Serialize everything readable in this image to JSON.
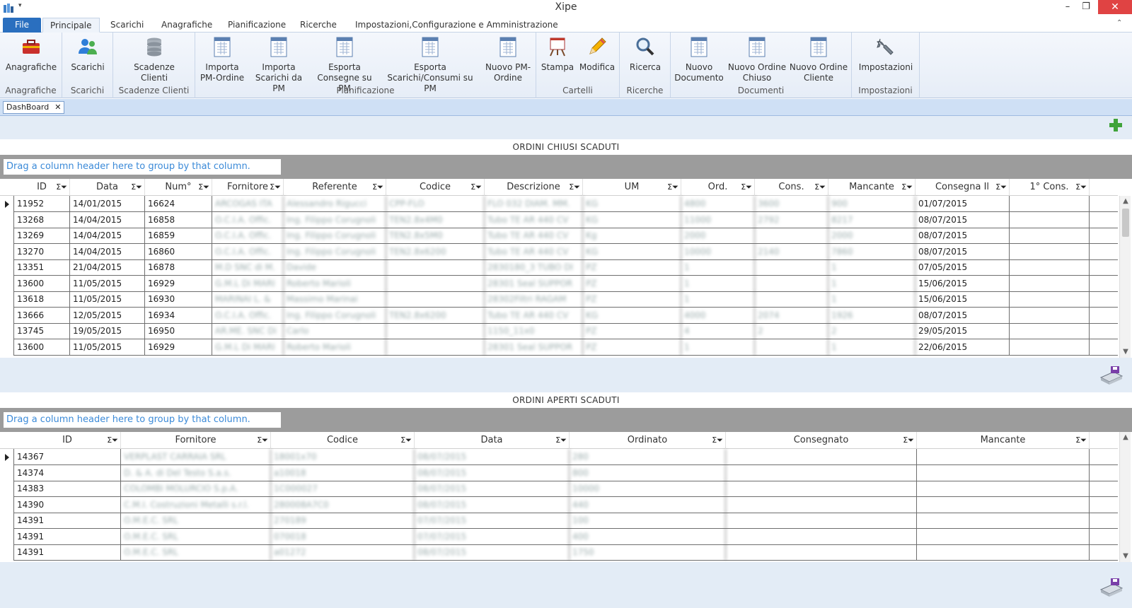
{
  "window": {
    "title": "Xipe",
    "minimize": "–",
    "maximize": "❐",
    "close": "✕",
    "qa_arrow": "▾"
  },
  "tabs": {
    "file": "File",
    "principale": "Principale",
    "scarichi": "Scarichi",
    "anagrafiche": "Anagrafiche",
    "pianificazione": "Pianificazione",
    "ricerche": "Ricerche",
    "impostazioni": "Impostazioni,Configurazione e Amministrazione",
    "collapse": "⌃"
  },
  "ribbon": {
    "groups": {
      "anagrafiche": "Anagrafiche",
      "scarichi": "Scarichi",
      "scadenze": "Scadenze Clienti",
      "pianificazione": "Pianificazione",
      "cartelli": "Cartelli",
      "ricerche": "Ricerche",
      "documenti": "Documenti",
      "impostazioni": "Impostazioni"
    },
    "buttons": {
      "anagrafiche": "Anagrafiche",
      "scarichi": "Scarichi",
      "scadenze": "Scadenze\nClienti",
      "importa_pm_ordine": "Importa\nPM-Ordine",
      "importa_scarichi": "Importa\nScarichi da PM",
      "esporta_consegne": "Esporta\nConsegne su PM",
      "esporta_scarichi": "Esporta\nScarichi/Consumi su PM",
      "nuovo_pm_ordine": "Nuovo PM-\nOrdine",
      "stampa": "Stampa",
      "modifica": "Modifica",
      "ricerca": "Ricerca",
      "nuovo_documento": "Nuovo\nDocumento",
      "nuovo_ordine_chiuso": "Nuovo Ordine\nChiuso",
      "nuovo_ordine_cliente": "Nuovo Ordine\nCliente",
      "impostazioni": "Impostazioni"
    }
  },
  "doc_tab": {
    "label": "DashBoard",
    "close": "✕"
  },
  "hint": "Drag a column header here to group by that column.",
  "sort_filter_glyph": "Σ⏷",
  "grid1": {
    "title": "ORDINI CHIUSI SCADUTI",
    "columns": [
      "ID",
      "Data",
      "Num°",
      "Fornitore",
      "Referente",
      "Codice",
      "Descrizione",
      "UM",
      "Ord.",
      "Cons.",
      "Mancante",
      "Consegna Il",
      "1° Cons."
    ],
    "rows": [
      [
        "11952",
        "14/01/2015",
        "16624",
        "ARCOGAS ITA",
        "Alessandro Rigucci",
        "CPP-FLO",
        "FLO 032 DIAM. MM.",
        "KG",
        "4800",
        "3600",
        "900",
        "01/07/2015",
        ""
      ],
      [
        "13268",
        "14/04/2015",
        "16858",
        "O.C.I.A. Offic.",
        "Ing. Filippo Corugnoli",
        "TEN2.8x4M0",
        "Tubo TE AR 440 CV",
        "KG",
        "11000",
        "2792",
        "8217",
        "08/07/2015",
        ""
      ],
      [
        "13269",
        "14/04/2015",
        "16859",
        "O.C.I.A. Offic.",
        "Ing. Filippo Corugnoli",
        "TEN2.8x5M0",
        "Tubo TE AR 440 CV",
        "Kg",
        "2000",
        "",
        "2000",
        "08/07/2015",
        ""
      ],
      [
        "13270",
        "14/04/2015",
        "16860",
        "O.C.I.A. Offic.",
        "Ing. Filippo Corugnoli",
        "TEN2.8x6200",
        "Tubo TE AR 440 CV",
        "KG",
        "10000",
        "2140",
        "7860",
        "08/07/2015",
        ""
      ],
      [
        "13351",
        "21/04/2015",
        "16878",
        "M.D SNC di M.",
        "Davide",
        "",
        "2830180_3 TUBO DI",
        "PZ",
        "1",
        "",
        "1",
        "07/05/2015",
        ""
      ],
      [
        "13600",
        "11/05/2015",
        "16929",
        "G.M.L Di MARI",
        "Roberto Marioli",
        "",
        "28301 Seal SUPPOR",
        "PZ",
        "1",
        "",
        "1",
        "15/06/2015",
        ""
      ],
      [
        "13618",
        "11/05/2015",
        "16930",
        "MARINAI L. &",
        "Massimo Marinai",
        "",
        "28302Filtri RAGAM",
        "PZ",
        "1",
        "",
        "1",
        "15/06/2015",
        ""
      ],
      [
        "13666",
        "12/05/2015",
        "16934",
        "O.C.I.A. Offic.",
        "Ing. Filippo Corugnoli",
        "TEN2.8x6200",
        "Tubo TE AR 440 CV",
        "KG",
        "4000",
        "2074",
        "1926",
        "08/07/2015",
        ""
      ],
      [
        "13745",
        "19/05/2015",
        "16950",
        "AR.ME. SNC Di",
        "Carlo",
        "",
        "1150_11x0",
        "PZ",
        "4",
        "2",
        "2",
        "29/05/2015",
        ""
      ],
      [
        "13600",
        "11/05/2015",
        "16929",
        "G.M.L Di MARI",
        "Roberto Marioli",
        "",
        "28301 Seal SUPPOR",
        "PZ",
        "1",
        "",
        "1",
        "22/06/2015",
        ""
      ]
    ]
  },
  "grid2": {
    "title": "ORDINI APERTI SCADUTI",
    "columns": [
      "ID",
      "Fornitore",
      "Codice",
      "Data",
      "Ordinato",
      "Consegnato",
      "Mancante"
    ],
    "rows": [
      [
        "14367",
        "VERPLAST CARRAIA SRL",
        "18001x70",
        "08/07/2015",
        "280",
        "",
        ""
      ],
      [
        "14374",
        "D. & A. di Del Testo S.a.s.",
        "a10018",
        "08/07/2015",
        "800",
        "",
        ""
      ],
      [
        "14383",
        "COLOMBI MOLURCIO S.p.A.",
        "1C000027",
        "08/07/2015",
        "10000",
        "",
        ""
      ],
      [
        "14390",
        "C.M.I. Costruzioni Metalli s.r.l.",
        "280008A7C0",
        "08/07/2015",
        "440",
        "",
        ""
      ],
      [
        "14391",
        "O.M.E.C. SRL",
        "270189",
        "07/07/2015",
        "100",
        "",
        ""
      ],
      [
        "14391",
        "O.M.E.C. SRL",
        "070018",
        "07/07/2015",
        "400",
        "",
        ""
      ],
      [
        "14391",
        "O.M.E.C. SRL",
        "a01272",
        "08/07/2015",
        "1750",
        "",
        ""
      ]
    ]
  }
}
